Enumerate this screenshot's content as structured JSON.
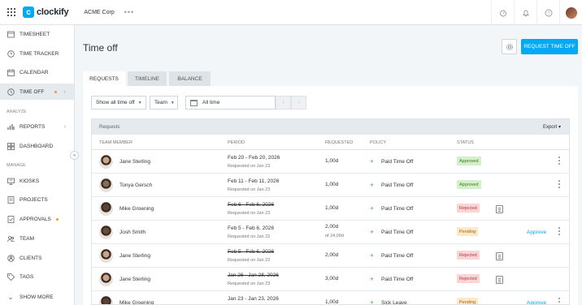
{
  "topbar": {
    "brand": "clockify",
    "brand_mark": "c",
    "workspace": "ACME Corp",
    "more": "•••",
    "icons": [
      "grid-icon",
      "timer-icon",
      "bell-icon",
      "help-icon"
    ]
  },
  "sidebar": {
    "items": [
      {
        "label": "Timesheet",
        "icon": "timesheet-icon"
      },
      {
        "label": "Time Tracker",
        "icon": "clock-icon"
      },
      {
        "label": "Calendar",
        "icon": "calendar-icon"
      },
      {
        "label": "Time Off",
        "icon": "time-off-icon"
      }
    ],
    "section_analyze": "Analyze",
    "analyze_items": [
      {
        "label": "Reports",
        "icon": "reports-icon"
      },
      {
        "label": "Dashboard",
        "icon": "dashboard-icon"
      }
    ],
    "section_manage": "Manage",
    "manage_items": [
      {
        "label": "Kiosks",
        "icon": "kiosk-icon"
      },
      {
        "label": "Projects",
        "icon": "projects-icon"
      },
      {
        "label": "Approvals",
        "icon": "approvals-icon"
      },
      {
        "label": "Team",
        "icon": "team-icon"
      },
      {
        "label": "Clients",
        "icon": "clients-icon"
      },
      {
        "label": "Tags",
        "icon": "tag-icon"
      }
    ],
    "show_more": "Show more"
  },
  "main": {
    "title": "Time off",
    "request_button": "Request time off",
    "tabs": [
      "Requests",
      "Timeline",
      "Balance"
    ],
    "filters": {
      "status": "Show all time off",
      "team": "Team",
      "date": "All time"
    },
    "table": {
      "title": "Requests",
      "export": "Export",
      "columns": [
        "Team member",
        "Period",
        "Requested",
        "Policy",
        "Status"
      ],
      "rows": [
        {
          "name": "Jane Sterling",
          "period": "Feb 20 - Feb 20, 2026",
          "requested_on": "Requested on Jan 23",
          "amount": "1,00d",
          "of": "",
          "policy": "Paid Time Off",
          "status": "Approved",
          "action": ""
        },
        {
          "name": "Tonya Gersch",
          "period": "Feb 11 - Feb 11, 2026",
          "requested_on": "Requested on Jan 23",
          "amount": "1,00d",
          "of": "",
          "policy": "Paid Time Off",
          "status": "Approved",
          "action": ""
        },
        {
          "name": "Mike Groening",
          "period": "Feb 6 - Feb 6, 2026",
          "requested_on": "Requested on Jan 23",
          "amount": "1,00d",
          "of": "",
          "policy": "Paid Time Off",
          "status": "Rejected",
          "action": ""
        },
        {
          "name": "Josh Smith",
          "period": "Feb 5 - Feb 6, 2026",
          "requested_on": "Requested on Jan 22",
          "amount": "2,00d",
          "of": "of 24,00d",
          "policy": "Paid Time Off",
          "status": "Pending",
          "action": "Approve"
        },
        {
          "name": "Jane Sterling",
          "period": "Feb 5 - Feb 6, 2026",
          "requested_on": "Requested on Jan 22",
          "amount": "2,00d",
          "of": "",
          "policy": "Paid Time Off",
          "status": "Rejected",
          "action": ""
        },
        {
          "name": "Jane Sterling",
          "period": "Jan 26 - Jan 28, 2026",
          "requested_on": "Requested on Jan 23",
          "amount": "3,00d",
          "of": "",
          "policy": "Paid Time Off",
          "status": "Rejected",
          "action": ""
        },
        {
          "name": "Mike Groening",
          "period": "Jan 23 - Jan 23, 2026",
          "requested_on": "",
          "amount": "1,00d",
          "of": "",
          "policy": "Sick Leave",
          "status": "Pending",
          "action": "Approve"
        }
      ]
    }
  },
  "colors": {
    "accent": "#03a9f4",
    "approved_bg": "#d4f0c9",
    "rejected_bg": "#fbd5d5",
    "pending_bg": "#fde8c8"
  }
}
